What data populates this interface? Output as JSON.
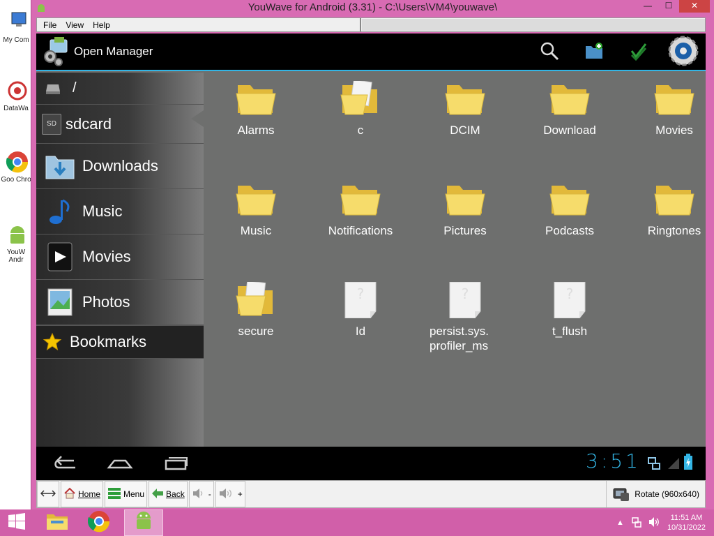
{
  "window": {
    "title": "YouWave for Android (3.31) - C:\\Users\\VM4\\youwave\\",
    "minimize": "—",
    "maximize": "☐",
    "close": "✕"
  },
  "desktop_icons": [
    "My Com",
    "DataWa",
    "Goo Chro",
    "YouW Andr"
  ],
  "menu": [
    "File",
    "View",
    "Help"
  ],
  "app": {
    "title": "Open Manager",
    "actions": [
      "search-icon",
      "new-folder-icon",
      "multiselect-icon",
      "settings-icon"
    ]
  },
  "sidebar": {
    "items": [
      {
        "label": "/",
        "icon": "drive-icon"
      },
      {
        "label": "sdcard",
        "icon": "sd-icon",
        "icon_text": "SD"
      },
      {
        "label": "Downloads",
        "icon": "download-folder-icon"
      },
      {
        "label": "Music",
        "icon": "music-note-icon"
      },
      {
        "label": "Movies",
        "icon": "play-icon"
      },
      {
        "label": "Photos",
        "icon": "photo-icon"
      },
      {
        "label": "Bookmarks",
        "icon": "star-icon"
      }
    ]
  },
  "files": [
    {
      "name": "Alarms",
      "type": "folder"
    },
    {
      "name": "c",
      "type": "folder-doc"
    },
    {
      "name": "DCIM",
      "type": "folder"
    },
    {
      "name": "Download",
      "type": "folder"
    },
    {
      "name": "Movies",
      "type": "folder"
    },
    {
      "name": "Music",
      "type": "folder"
    },
    {
      "name": "Notifications",
      "type": "folder"
    },
    {
      "name": "Pictures",
      "type": "folder"
    },
    {
      "name": "Podcasts",
      "type": "folder"
    },
    {
      "name": "Ringtones",
      "type": "folder"
    },
    {
      "name": "secure",
      "type": "folder-doc"
    },
    {
      "name": "Id",
      "type": "file"
    },
    {
      "name": "persist.sys.\nprofiler_ms",
      "type": "file"
    },
    {
      "name": "t_flush",
      "type": "file"
    }
  ],
  "statusbar": {
    "time": "3:51"
  },
  "controls": {
    "home": "Home",
    "menu": "Menu",
    "back": "Back",
    "vol_down": "-",
    "vol_up": "+",
    "rotate": "Rotate (960x640)"
  },
  "taskbar": {
    "time": "11:51 AM",
    "date": "10/31/2022"
  },
  "colors": {
    "accent": "#33b5e5",
    "folder": "#f2d24b",
    "taskbar": "#d15fa9"
  }
}
